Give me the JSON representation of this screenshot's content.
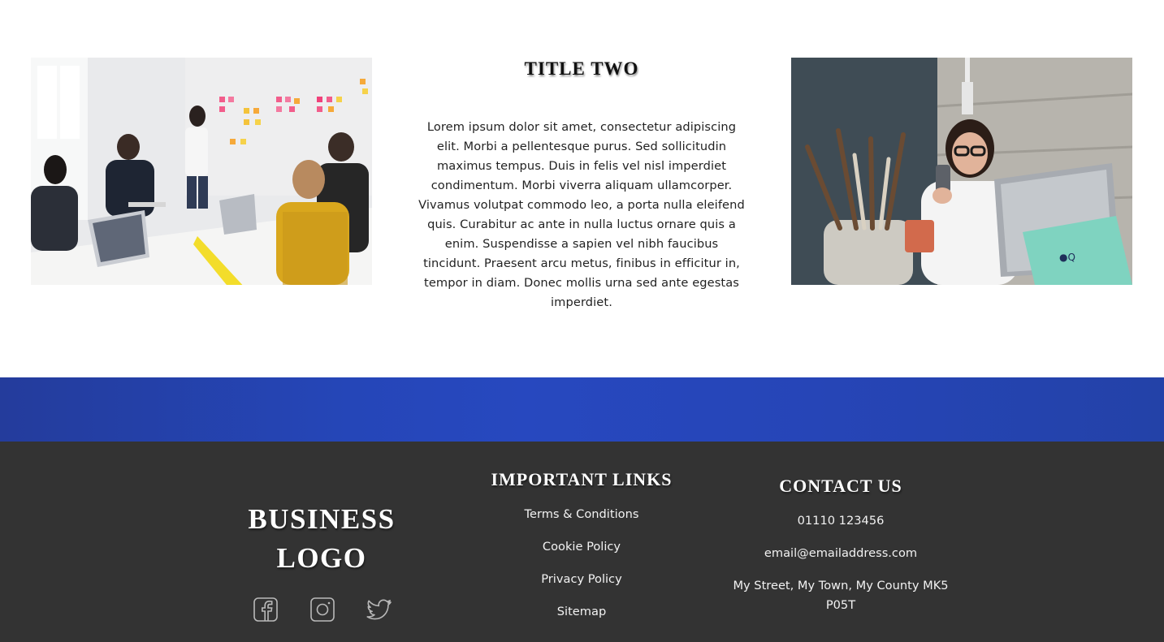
{
  "section": {
    "title": "TITLE TWO",
    "body": "Lorem ipsum dolor sit amet, consectetur adipiscing elit. Morbi a pellentesque purus. Sed sollicitudin maximus tempus. Duis in felis vel nisl imperdiet condimentum. Morbi viverra aliquam ullamcorper. Vivamus volutpat commodo leo, a porta nulla eleifend quis. Curabitur ac ante in nulla luctus ornare quis a enim. Suspendisse a sapien vel nibh faucibus tincidunt. Praesent arcu metus, finibus in efficitur in, tempor in diam. Donec mollis urna sed ante egestas imperdiet."
  },
  "footer": {
    "logo_line1": "BUSINESS",
    "logo_line2": "LOGO",
    "social_icons": [
      "facebook-icon",
      "instagram-icon",
      "twitter-icon"
    ],
    "links_title": "IMPORTANT LINKS",
    "links": [
      "Terms & Conditions",
      "Cookie Policy",
      "Privacy Policy",
      "Sitemap"
    ],
    "contact_title": "CONTACT US",
    "phone": "01110 123456",
    "email": "email@emailaddress.com",
    "address_line1": "My Street, My Town, My County MK5",
    "address_line2": "P05T"
  },
  "colors": {
    "band": "#2546b8",
    "footer_bg": "#333333",
    "text_light": "#ffffff"
  }
}
